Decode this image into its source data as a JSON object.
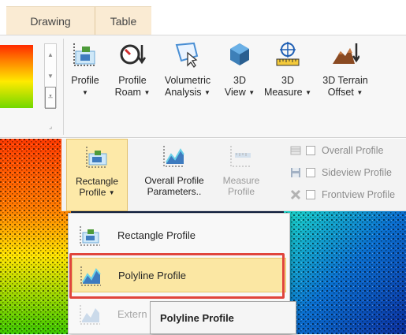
{
  "tabs": [
    {
      "label": "Drawing"
    },
    {
      "label": "Table"
    }
  ],
  "ribbon": {
    "buttons": [
      {
        "line1": "Profile",
        "line2": "",
        "icon": "profile-icon"
      },
      {
        "line1": "Profile",
        "line2": "Roam",
        "icon": "profile-roam-icon"
      },
      {
        "line1": "Volumetric",
        "line2": "Analysis",
        "icon": "volumetric-analysis-icon"
      },
      {
        "line1": "3D",
        "line2": "View",
        "icon": "3d-view-icon"
      },
      {
        "line1": "3D",
        "line2": "Measure",
        "icon": "3d-measure-icon"
      },
      {
        "line1": "3D Terrain",
        "line2": "Offset",
        "icon": "3d-terrain-offset-icon"
      }
    ]
  },
  "subtoolbar": {
    "buttons": [
      {
        "line1": "Rectangle",
        "line2": "Profile",
        "icon": "rectangle-profile-icon"
      },
      {
        "line1": "Overall Profile",
        "line2": "Parameters..",
        "icon": "overall-profile-parameters-icon"
      },
      {
        "line1": "Measure",
        "line2": "Profile",
        "icon": "measure-profile-icon"
      }
    ],
    "checkboxes": [
      {
        "label": "Overall Profile",
        "checked": false
      },
      {
        "label": "Sideview Profile",
        "checked": false
      },
      {
        "label": "Frontview Profile",
        "checked": false
      }
    ]
  },
  "dropdown": {
    "items": [
      {
        "label": "Rectangle Profile",
        "icon": "rectangle-profile-icon",
        "state": "normal"
      },
      {
        "label": "Polyline Profile",
        "icon": "polyline-profile-icon",
        "state": "highlighted"
      },
      {
        "label": "Extern",
        "icon": "extern-profile-icon",
        "state": "disabled"
      }
    ]
  },
  "tooltip": {
    "title": "Polyline Profile"
  },
  "colors": {
    "tab_bg": "#faebd3",
    "highlight": "#fbe7a3",
    "highlight_border": "#e9c66b",
    "annotation_red": "#e0453c"
  }
}
